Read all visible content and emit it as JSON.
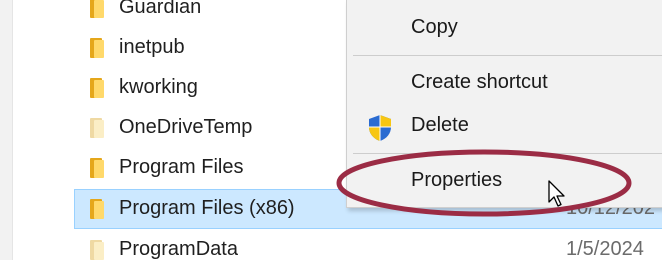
{
  "files": [
    {
      "name": "Guardian",
      "date": "",
      "pale": false
    },
    {
      "name": "inetpub",
      "date": "",
      "pale": false
    },
    {
      "name": "kworking",
      "date": "",
      "pale": false
    },
    {
      "name": "OneDriveTemp",
      "date": "",
      "pale": true
    },
    {
      "name": "Program Files",
      "date": "",
      "pale": false
    },
    {
      "name": "Program Files (x86)",
      "date": "10/12/202",
      "pale": false,
      "selected": true
    },
    {
      "name": "ProgramData",
      "date": "1/5/2024",
      "pale": true
    }
  ],
  "context_menu": {
    "items": [
      {
        "label": "Copy"
      },
      {
        "label": "Create shortcut"
      },
      {
        "label": "Delete",
        "icon": "uac-shield-icon"
      },
      {
        "label": "Properties"
      }
    ]
  },
  "annotation": {
    "highlight_color": "#9b2c45"
  },
  "colors": {
    "selection": "#cce8ff",
    "selection_border": "#99d1ff",
    "menu_bg": "#f2f2f2"
  }
}
